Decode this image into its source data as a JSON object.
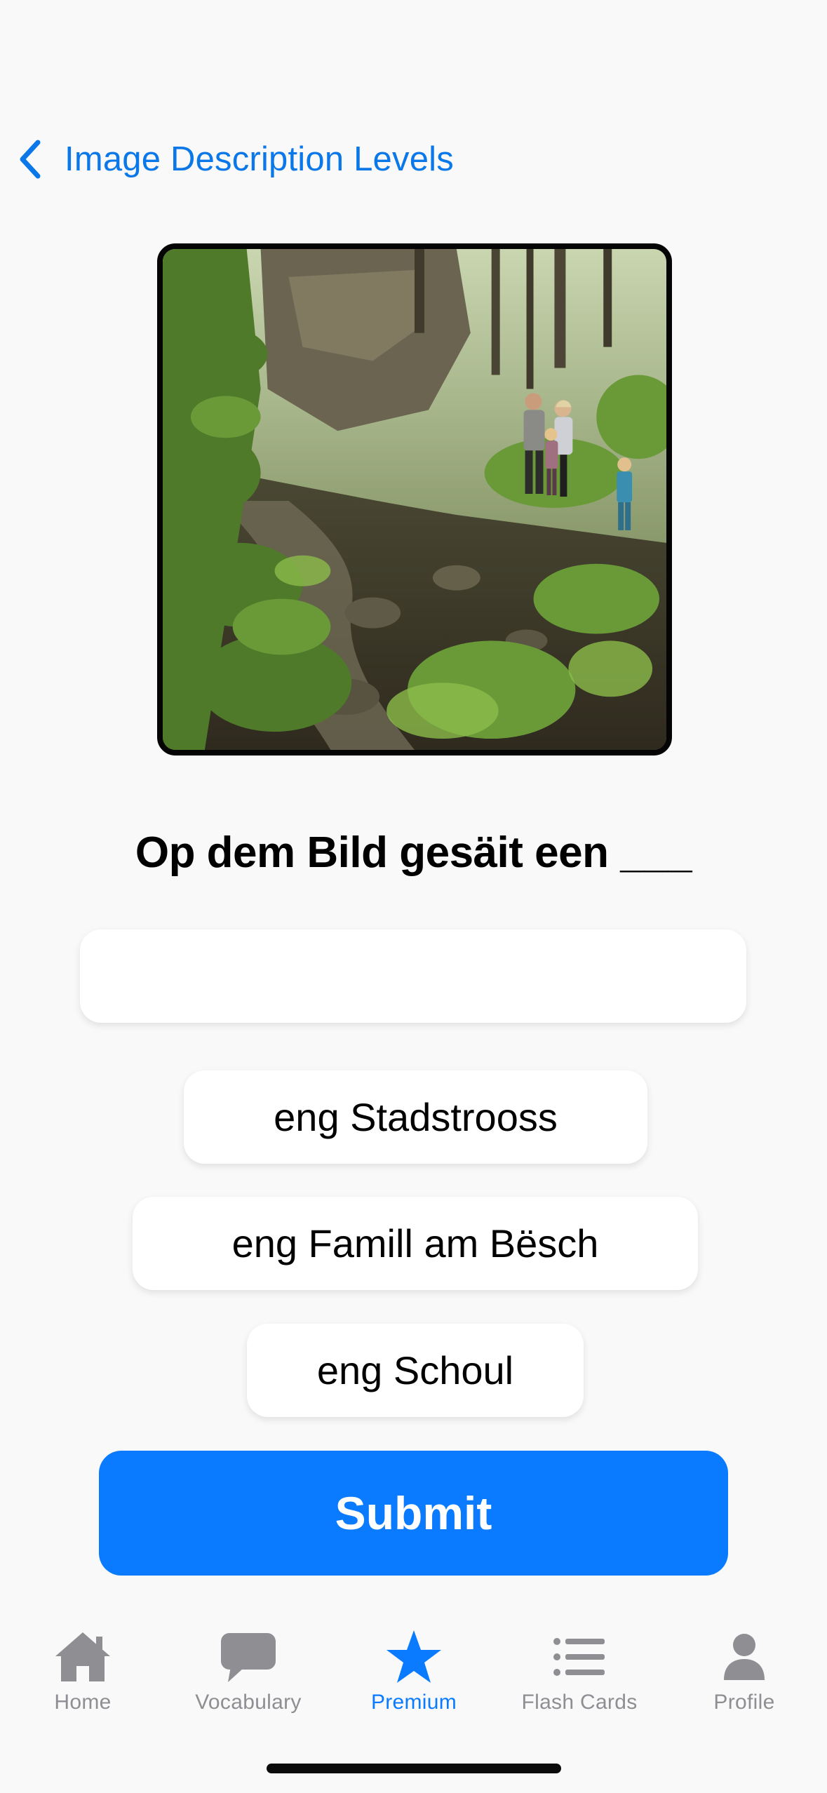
{
  "nav": {
    "back_label": "Image Description Levels",
    "back_icon": "chevron-left-icon"
  },
  "image": {
    "subject": "family-in-forest-photo"
  },
  "question": {
    "text": "Op dem Bild gesäit een ___"
  },
  "answer": {
    "value": ""
  },
  "options": [
    {
      "label": "eng Stadstrooss"
    },
    {
      "label": "eng Famill am Bësch"
    },
    {
      "label": "eng Schoul"
    }
  ],
  "submit": {
    "label": "Submit"
  },
  "tabbar": {
    "active": "Premium",
    "tabs": [
      {
        "label": "Home",
        "icon": "house-icon"
      },
      {
        "label": "Vocabulary",
        "icon": "speech-bubble-icon"
      },
      {
        "label": "Premium",
        "icon": "star-icon"
      },
      {
        "label": "Flash Cards",
        "icon": "list-icon"
      },
      {
        "label": "Profile",
        "icon": "person-icon"
      }
    ]
  },
  "colors": {
    "accent": "#0a7bff",
    "link": "#0a78e8",
    "inactive_tab": "#8e8e93",
    "background": "#f9f9f9"
  }
}
